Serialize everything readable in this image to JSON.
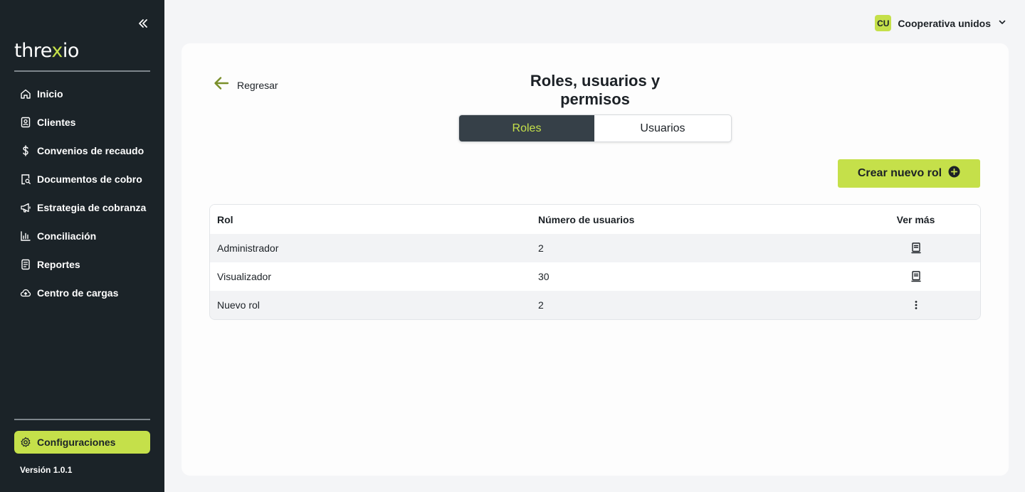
{
  "sidebar": {
    "logo": "threxio",
    "items": [
      {
        "label": "Inicio",
        "icon": "home-icon"
      },
      {
        "label": "Clientes",
        "icon": "contact-card-icon"
      },
      {
        "label": "Convenios de recaudo",
        "icon": "dollar-icon"
      },
      {
        "label": "Documentos de cobro",
        "icon": "document-search-icon"
      },
      {
        "label": "Estrategia de cobranza",
        "icon": "megaphone-icon"
      },
      {
        "label": "Conciliación",
        "icon": "bar-chart-icon"
      },
      {
        "label": "Reportes",
        "icon": "report-icon"
      },
      {
        "label": "Centro de cargas",
        "icon": "cloud-upload-icon"
      }
    ],
    "config_label": "Configuraciones",
    "version": "Versión 1.0.1"
  },
  "header": {
    "org_initials": "CU",
    "org_name": "Cooperativa unidos"
  },
  "page": {
    "back_label": "Regresar",
    "title": "Roles, usuarios y permisos",
    "tabs": [
      "Roles",
      "Usuarios"
    ],
    "active_tab": "Roles",
    "create_label": "Crear nuevo rol"
  },
  "table": {
    "headers": [
      "Rol",
      "Número de usuarios",
      "Ver más"
    ],
    "rows": [
      {
        "rol": "Administrador",
        "users": "2",
        "action_icon": "document-icon"
      },
      {
        "rol": "Visualizador",
        "users": "30",
        "action_icon": "document-icon"
      },
      {
        "rol": "Nuevo rol",
        "users": "2",
        "action_icon": "more-vertical-icon"
      }
    ]
  },
  "colors": {
    "sidebar_bg": "#1b2328",
    "accent": "#c5e04a",
    "tab_active_bg": "#364048",
    "back_arrow": "#7a8f2a"
  }
}
